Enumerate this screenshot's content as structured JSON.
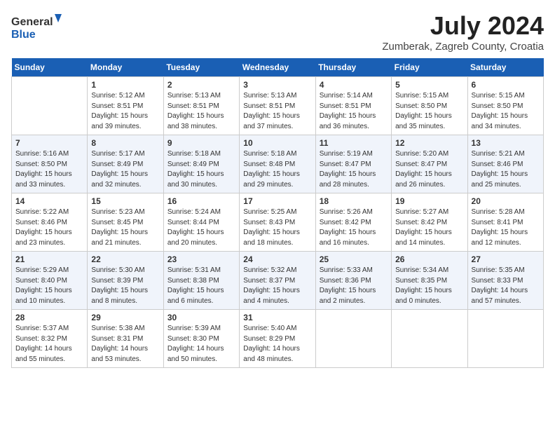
{
  "header": {
    "logo": {
      "general": "General",
      "blue": "Blue"
    },
    "title": "July 2024",
    "location": "Zumberak, Zagreb County, Croatia"
  },
  "weekdays": [
    "Sunday",
    "Monday",
    "Tuesday",
    "Wednesday",
    "Thursday",
    "Friday",
    "Saturday"
  ],
  "weeks": [
    [
      {
        "day": "",
        "info": ""
      },
      {
        "day": "1",
        "info": "Sunrise: 5:12 AM\nSunset: 8:51 PM\nDaylight: 15 hours\nand 39 minutes."
      },
      {
        "day": "2",
        "info": "Sunrise: 5:13 AM\nSunset: 8:51 PM\nDaylight: 15 hours\nand 38 minutes."
      },
      {
        "day": "3",
        "info": "Sunrise: 5:13 AM\nSunset: 8:51 PM\nDaylight: 15 hours\nand 37 minutes."
      },
      {
        "day": "4",
        "info": "Sunrise: 5:14 AM\nSunset: 8:51 PM\nDaylight: 15 hours\nand 36 minutes."
      },
      {
        "day": "5",
        "info": "Sunrise: 5:15 AM\nSunset: 8:50 PM\nDaylight: 15 hours\nand 35 minutes."
      },
      {
        "day": "6",
        "info": "Sunrise: 5:15 AM\nSunset: 8:50 PM\nDaylight: 15 hours\nand 34 minutes."
      }
    ],
    [
      {
        "day": "7",
        "info": "Sunrise: 5:16 AM\nSunset: 8:50 PM\nDaylight: 15 hours\nand 33 minutes."
      },
      {
        "day": "8",
        "info": "Sunrise: 5:17 AM\nSunset: 8:49 PM\nDaylight: 15 hours\nand 32 minutes."
      },
      {
        "day": "9",
        "info": "Sunrise: 5:18 AM\nSunset: 8:49 PM\nDaylight: 15 hours\nand 30 minutes."
      },
      {
        "day": "10",
        "info": "Sunrise: 5:18 AM\nSunset: 8:48 PM\nDaylight: 15 hours\nand 29 minutes."
      },
      {
        "day": "11",
        "info": "Sunrise: 5:19 AM\nSunset: 8:47 PM\nDaylight: 15 hours\nand 28 minutes."
      },
      {
        "day": "12",
        "info": "Sunrise: 5:20 AM\nSunset: 8:47 PM\nDaylight: 15 hours\nand 26 minutes."
      },
      {
        "day": "13",
        "info": "Sunrise: 5:21 AM\nSunset: 8:46 PM\nDaylight: 15 hours\nand 25 minutes."
      }
    ],
    [
      {
        "day": "14",
        "info": "Sunrise: 5:22 AM\nSunset: 8:46 PM\nDaylight: 15 hours\nand 23 minutes."
      },
      {
        "day": "15",
        "info": "Sunrise: 5:23 AM\nSunset: 8:45 PM\nDaylight: 15 hours\nand 21 minutes."
      },
      {
        "day": "16",
        "info": "Sunrise: 5:24 AM\nSunset: 8:44 PM\nDaylight: 15 hours\nand 20 minutes."
      },
      {
        "day": "17",
        "info": "Sunrise: 5:25 AM\nSunset: 8:43 PM\nDaylight: 15 hours\nand 18 minutes."
      },
      {
        "day": "18",
        "info": "Sunrise: 5:26 AM\nSunset: 8:42 PM\nDaylight: 15 hours\nand 16 minutes."
      },
      {
        "day": "19",
        "info": "Sunrise: 5:27 AM\nSunset: 8:42 PM\nDaylight: 15 hours\nand 14 minutes."
      },
      {
        "day": "20",
        "info": "Sunrise: 5:28 AM\nSunset: 8:41 PM\nDaylight: 15 hours\nand 12 minutes."
      }
    ],
    [
      {
        "day": "21",
        "info": "Sunrise: 5:29 AM\nSunset: 8:40 PM\nDaylight: 15 hours\nand 10 minutes."
      },
      {
        "day": "22",
        "info": "Sunrise: 5:30 AM\nSunset: 8:39 PM\nDaylight: 15 hours\nand 8 minutes."
      },
      {
        "day": "23",
        "info": "Sunrise: 5:31 AM\nSunset: 8:38 PM\nDaylight: 15 hours\nand 6 minutes."
      },
      {
        "day": "24",
        "info": "Sunrise: 5:32 AM\nSunset: 8:37 PM\nDaylight: 15 hours\nand 4 minutes."
      },
      {
        "day": "25",
        "info": "Sunrise: 5:33 AM\nSunset: 8:36 PM\nDaylight: 15 hours\nand 2 minutes."
      },
      {
        "day": "26",
        "info": "Sunrise: 5:34 AM\nSunset: 8:35 PM\nDaylight: 15 hours\nand 0 minutes."
      },
      {
        "day": "27",
        "info": "Sunrise: 5:35 AM\nSunset: 8:33 PM\nDaylight: 14 hours\nand 57 minutes."
      }
    ],
    [
      {
        "day": "28",
        "info": "Sunrise: 5:37 AM\nSunset: 8:32 PM\nDaylight: 14 hours\nand 55 minutes."
      },
      {
        "day": "29",
        "info": "Sunrise: 5:38 AM\nSunset: 8:31 PM\nDaylight: 14 hours\nand 53 minutes."
      },
      {
        "day": "30",
        "info": "Sunrise: 5:39 AM\nSunset: 8:30 PM\nDaylight: 14 hours\nand 50 minutes."
      },
      {
        "day": "31",
        "info": "Sunrise: 5:40 AM\nSunset: 8:29 PM\nDaylight: 14 hours\nand 48 minutes."
      },
      {
        "day": "",
        "info": ""
      },
      {
        "day": "",
        "info": ""
      },
      {
        "day": "",
        "info": ""
      }
    ]
  ]
}
